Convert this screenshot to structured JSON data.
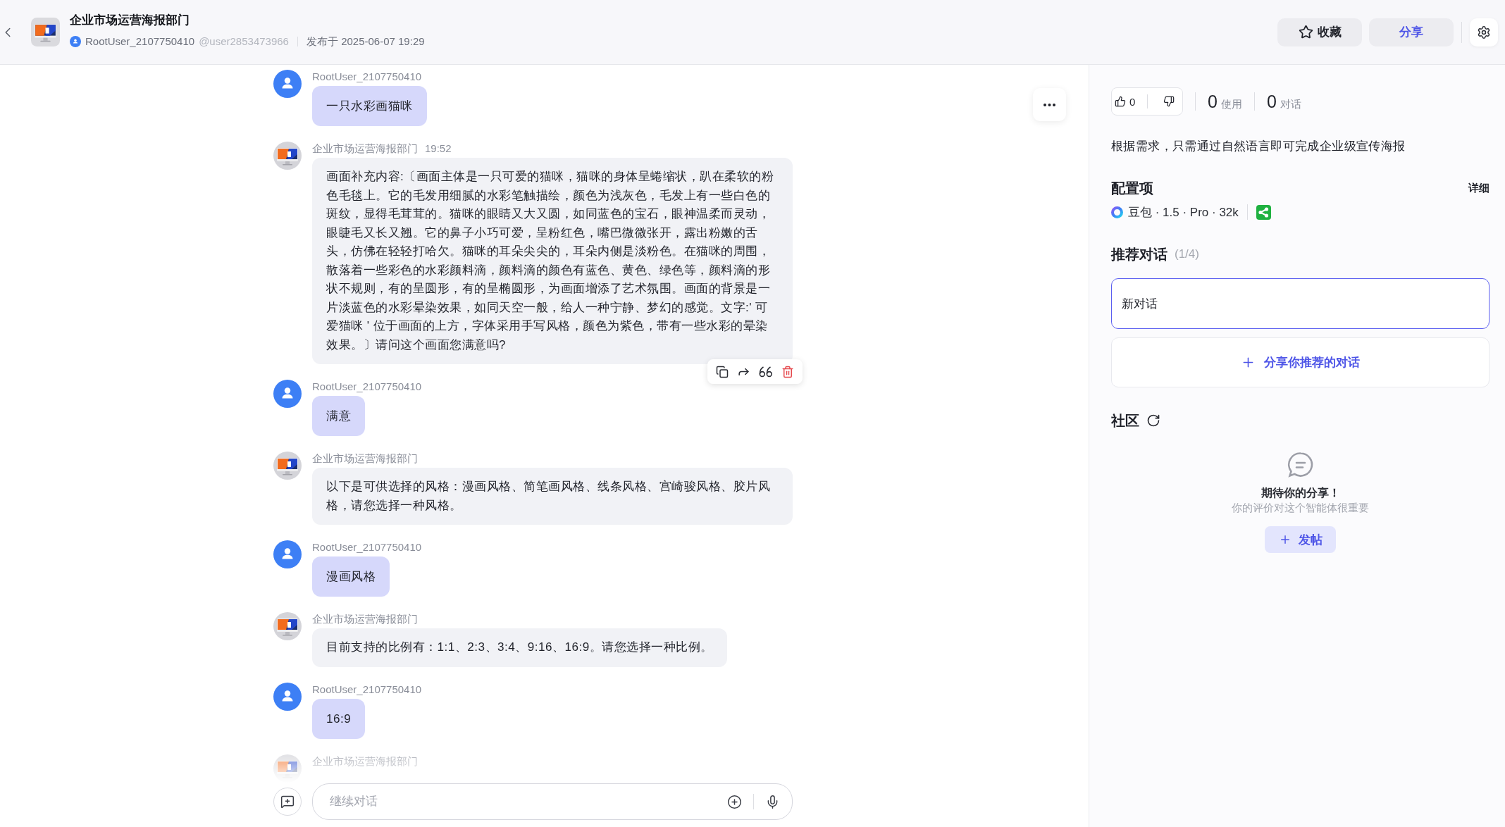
{
  "header": {
    "title": "企业市场运营海报部门",
    "author": "RootUser_2107750410",
    "handle": "@user2853473966",
    "published": "发布于 2025-06-07 19:29",
    "buttons": [
      {
        "kind": "favorite",
        "label": "收藏"
      },
      {
        "kind": "share",
        "label": "分享"
      }
    ]
  },
  "messages": [
    {
      "kind": "user",
      "name": "RootUser_2107750410",
      "text": "一只水彩画猫咪",
      "toolbar_shown": false
    },
    {
      "kind": "bot",
      "name": "企业市场运营海报部门",
      "time": "19:52",
      "text": "画面补充内容:〔画面主体是一只可爱的猫咪，猫咪的身体呈蜷缩状，趴在柔软的粉色毛毯上。它的毛发用细腻的水彩笔触描绘，颜色为浅灰色，毛发上有一些白色的斑纹，显得毛茸茸的。猫咪的眼睛又大又圆，如同蓝色的宝石，眼神温柔而灵动，眼睫毛又长又翘。它的鼻子小巧可爱，呈粉红色，嘴巴微微张开，露出粉嫩的舌头，仿佛在轻轻打哈欠。猫咪的耳朵尖尖的，耳朵内侧是淡粉色。在猫咪的周围，散落着一些彩色的水彩颜料滴，颜料滴的颜色有蓝色、黄色、绿色等，颜料滴的形状不规则，有的呈圆形，有的呈椭圆形，为画面增添了艺术氛围。画面的背景是一片淡蓝色的水彩晕染效果，如同天空一般，给人一种宁静、梦幻的感觉。文字:' 可爱猫咪 ' 位于画面的上方，字体采用手写风格，颜色为紫色，带有一些水彩的晕染效果。〕请问这个画面您满意吗?",
      "toolbar_shown": true
    },
    {
      "kind": "user",
      "name": "RootUser_2107750410",
      "text": "满意",
      "toolbar_shown": false
    },
    {
      "kind": "bot",
      "name": "企业市场运营海报部门",
      "text": "以下是可供选择的风格：漫画风格、简笔画风格、线条风格、宫崎骏风格、胶片风格，请您选择一种风格。",
      "toolbar_shown": false
    },
    {
      "kind": "user",
      "name": "RootUser_2107750410",
      "text": "漫画风格",
      "toolbar_shown": false
    },
    {
      "kind": "bot",
      "name": "企业市场运营海报部门",
      "text": "目前支持的比例有：1:1、2:3、3:4、9:16、16:9。请您选择一种比例。",
      "toolbar_shown": false
    },
    {
      "kind": "user",
      "name": "RootUser_2107750410",
      "text": "16:9",
      "toolbar_shown": false
    },
    {
      "kind": "bot",
      "name": "企业市场运营海报部门",
      "toolbar_shown": false
    }
  ],
  "composer": {
    "placeholder": "继续对话"
  },
  "sidebar": {
    "likes": "0",
    "stats": [
      {
        "value": "0",
        "label": "使用"
      },
      {
        "value": "0",
        "label": "对话"
      }
    ],
    "description": "根据需求，只需通过自然语言即可完成企业级宣传海报",
    "config": {
      "title": "配置项",
      "detail_link": "详细",
      "model": "豆包 · 1.5 · Pro · 32k"
    },
    "recommended": {
      "title": "推荐对话",
      "count": "(1/4)",
      "items": [
        {
          "label": "新对话",
          "selected": true
        }
      ],
      "add_button": "分享你推荐的对话"
    },
    "community": {
      "title": "社区",
      "empty_title": "期待你的分享！",
      "empty_subtitle": "你的评价对这个智能体很重要",
      "post_button": "发帖"
    }
  }
}
